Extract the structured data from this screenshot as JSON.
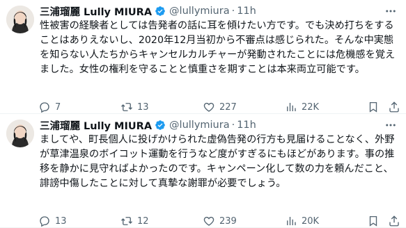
{
  "tweets": [
    {
      "name": "三浦瑠麗 Lully MIURA",
      "handle": "@lullymiura",
      "separator": "·",
      "time": "11h",
      "text": "性被害の経験者としては告発者の話に耳を傾けたい方です。でも決め打ちをすることはありえないし、2020年12月当初から不審点は感じられた。そんな中実態を知らない人たちからキャンセルカルチャーが発動されたことには危機感を覚えました。女性の権利を守ることと慎重さを期すことは本来両立可能です。",
      "replies": "7",
      "reposts": "13",
      "likes": "227",
      "views": "22K"
    },
    {
      "name": "三浦瑠麗 Lully MIURA",
      "handle": "@lullymiura",
      "separator": "·",
      "time": "11h",
      "text": "ましてや、町長個人に投げかけられた虚偽告発の行方も見届けることなく、外野が草津温泉のボイコット運動を行うなど度がすぎるにもほどがあります。事の推移を静かに見守ればよかったのです。キャンペーン化して数の力を頼んだこと、誹謗中傷したことに対して真摯な謝罪が必要でしょう。",
      "replies": "13",
      "reposts": "12",
      "likes": "239",
      "views": "20K"
    }
  ],
  "colors": {
    "verified_badge": "#1d9bf0",
    "secondary_text": "#536471",
    "primary_text": "#0f1419"
  },
  "icons": [
    "verified-badge-icon",
    "more-icon",
    "reply-icon",
    "repost-icon",
    "like-icon",
    "views-icon",
    "bookmark-icon",
    "share-icon"
  ]
}
